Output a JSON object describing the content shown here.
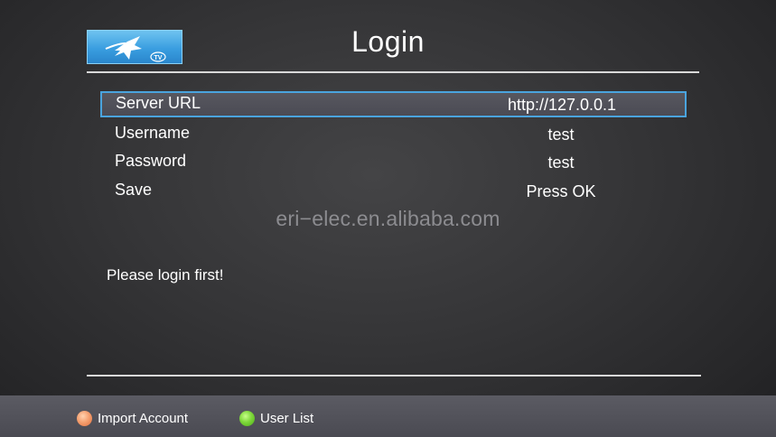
{
  "header": {
    "title": "Login",
    "logo_icon": "star-tv-logo",
    "logo_text": "TV"
  },
  "form": {
    "rows": [
      {
        "label": "Server URL",
        "value": "http://127.0.0.1",
        "selected": true
      },
      {
        "label": "Username",
        "value": "test",
        "selected": false
      },
      {
        "label": "Password",
        "value": "test",
        "selected": false
      },
      {
        "label": "Save",
        "value": "Press OK",
        "selected": false
      }
    ]
  },
  "watermark": "eri−elec.en.alibaba.com",
  "message": "Please login first!",
  "footer": {
    "items": [
      {
        "label": "Import Account",
        "icon": "orange-button-icon",
        "color": "#f4a070"
      },
      {
        "label": "User List",
        "icon": "green-button-icon",
        "color": "#7ed83a"
      }
    ]
  },
  "colors": {
    "selection_border": "#4aa4de",
    "logo_blue": "#3a9ee0"
  }
}
